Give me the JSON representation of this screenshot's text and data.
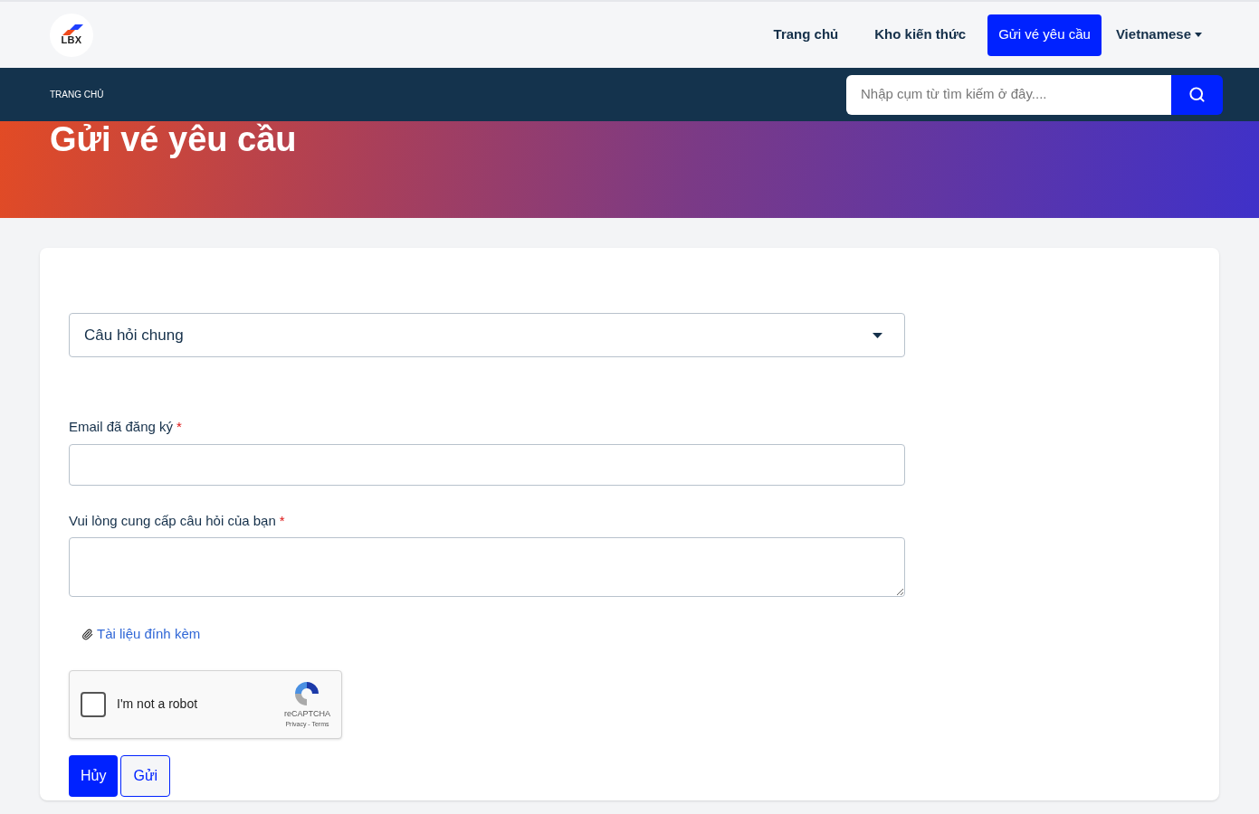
{
  "header": {
    "logo_text": "LBX",
    "nav": [
      {
        "label": "Trang chủ",
        "selected": false
      },
      {
        "label": "Kho kiến thức",
        "selected": false
      },
      {
        "label": "Gửi vé yêu cầu",
        "selected": true
      }
    ],
    "language": "Vietnamese"
  },
  "breadcrumb": "TRANG CHỦ",
  "search": {
    "placeholder": "Nhập cụm từ tìm kiếm ở đây...."
  },
  "hero": {
    "title": "Gửi vé yêu cầu"
  },
  "form": {
    "category": "Câu hỏi chung",
    "fields": [
      {
        "kind": "input",
        "label": "Email đã đăng ký",
        "required_mark": "*"
      },
      {
        "kind": "textarea",
        "label": "Vui lòng cung cấp câu hỏi của bạn",
        "required_mark": "*"
      }
    ],
    "attachment": "Tài liệu đính kèm",
    "captcha": {
      "label": "I'm not a robot",
      "checked": false,
      "brand": "reCAPTCHA",
      "links": "Privacy - Terms"
    },
    "buttons": [
      {
        "label": "Hủy",
        "kind": "primary"
      },
      {
        "label": "Gửi",
        "kind": "outline"
      }
    ]
  }
}
